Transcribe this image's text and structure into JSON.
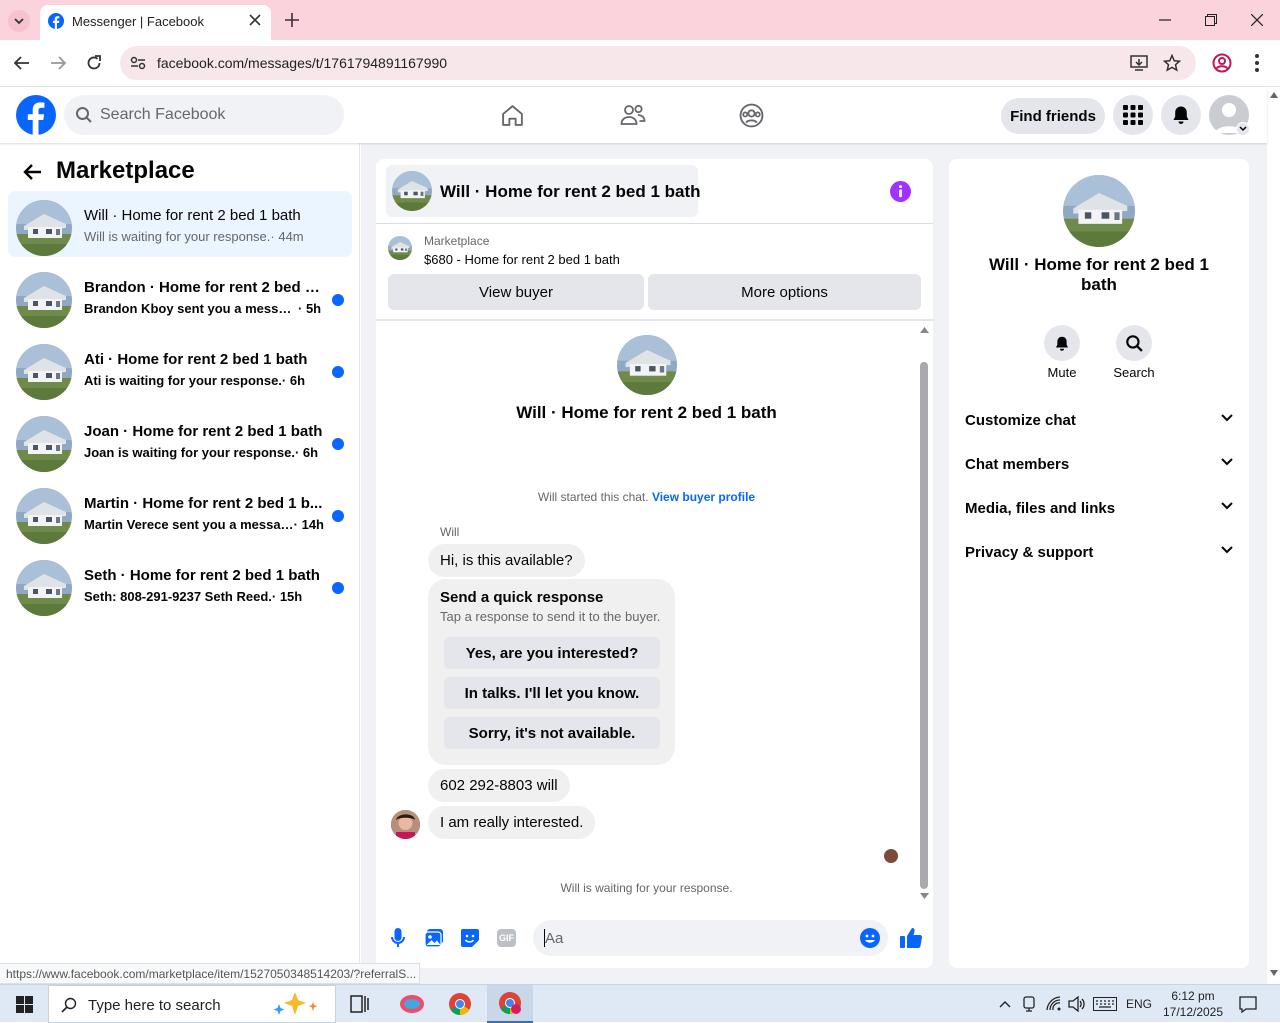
{
  "browser": {
    "tab_title": "Messenger | Facebook",
    "url": "facebook.com/messages/t/1761794891167990",
    "status_url": "https://www.facebook.com/marketplace/item/1527050348514203/?referralS..."
  },
  "fb_header": {
    "search_placeholder": "Search Facebook",
    "find_friends": "Find friends"
  },
  "sidebar": {
    "title": "Marketplace",
    "conversations": [
      {
        "title": "Will · Home for rent 2 bed 1 bath",
        "message": "Will is waiting for your response.",
        "time": "· 44m",
        "unread": false,
        "selected": true
      },
      {
        "title": "Brandon · Home for rent 2 bed 1 ...",
        "message": "Brandon Kboy sent you a message...",
        "time": "· 5h",
        "unread": true,
        "selected": false
      },
      {
        "title": "Ati · Home for rent 2 bed 1 bath",
        "message": "Ati is waiting for your response.",
        "time": "· 6h",
        "unread": true,
        "selected": false
      },
      {
        "title": "Joan · Home for rent 2 bed 1 bath",
        "message": "Joan is waiting for your response.",
        "time": "· 6h",
        "unread": true,
        "selected": false
      },
      {
        "title": "Martin · Home for rent 2 bed 1 b...",
        "message": "Martin Verece sent you a messag...",
        "time": "· 14h",
        "unread": true,
        "selected": false
      },
      {
        "title": "Seth · Home for rent 2 bed 1 bath",
        "message": "Seth: 808-291-9237 Seth Reed.",
        "time": "· 15h",
        "unread": true,
        "selected": false
      }
    ]
  },
  "chat": {
    "header_title": "Will · Home for rent 2 bed 1 bath",
    "listing_source": "Marketplace",
    "listing_title": "$680 - Home for rent 2 bed 1 bath",
    "view_buyer": "View buyer",
    "more_options": "More options",
    "intro_name": "Will · Home for rent 2 bed 1 bath",
    "started_text": "Will started this chat.",
    "view_profile_link": "View buyer profile",
    "sender_name": "Will",
    "msg1": "Hi, is this available?",
    "quick_title": "Send a quick response",
    "quick_sub": "Tap a response to send it to the buyer.",
    "quick_replies": [
      "Yes, are you interested?",
      "In talks. I'll let you know.",
      "Sorry, it's not available."
    ],
    "msg2": "602 292-8803 will",
    "msg3": "I am really interested.",
    "waiting": "Will is waiting for your response.",
    "composer_placeholder": "Aa"
  },
  "info_panel": {
    "name": "Will · Home for rent 2 bed 1 bath",
    "mute": "Mute",
    "search": "Search",
    "sections": [
      "Customize chat",
      "Chat members",
      "Media, files and links",
      "Privacy & support"
    ]
  },
  "taskbar": {
    "search_placeholder": "Type here to search",
    "lang": "ENG",
    "time": "6:12 pm",
    "date": "17/12/2025"
  },
  "colors": {
    "fb_blue": "#0866ff",
    "info_purple": "#a033ff",
    "tab_pink": "#fbd3dc"
  }
}
